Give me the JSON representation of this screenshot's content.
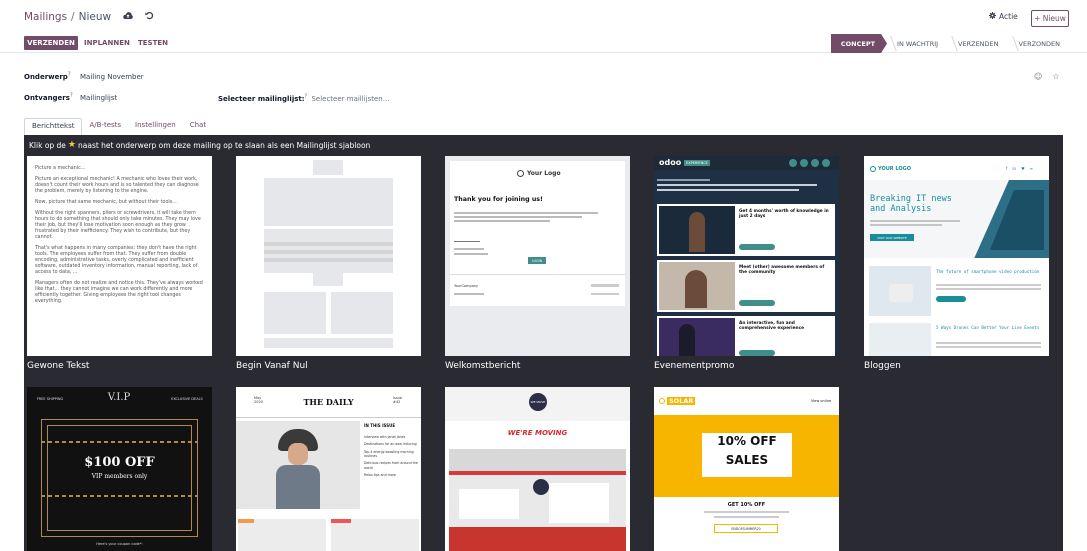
{
  "header": {
    "app": "Mailings",
    "separator": "/",
    "current": "Nieuw",
    "actie_label": "Actie",
    "new_button": "+ Nieuw"
  },
  "actionbar": {
    "send": "VERZENDEN",
    "schedule": "INPLANNEN",
    "test": "TESTEN",
    "stages": [
      "CONCEPT",
      "IN WACHTRIJ",
      "VERZENDEN",
      "VERZONDEN"
    ]
  },
  "form": {
    "subject_label": "Onderwerp",
    "subject_value": "Mailing November",
    "recipients_label": "Ontvangers",
    "recipients_value": "Mailinglijst",
    "mailinglist_label": "Selecteer mailinglijst:",
    "mailinglist_placeholder": "Selecteer maillijsten...",
    "tooltip_mark": "?"
  },
  "tabs": [
    "Berichttekst",
    "A/B-tests",
    "Instellingen",
    "Chat"
  ],
  "templates": {
    "hint_before": "Klik op de",
    "hint_after": "naast het onderwerp om deze mailing op te slaan als een Mailinglijst sjabloon",
    "names": [
      "Gewone Tekst",
      "Begin Vanaf Nul",
      "Welkomstbericht",
      "Evenementpromo",
      "Bloggen"
    ]
  },
  "thumbs": {
    "plain": {
      "p1": "Picture a mechanic...",
      "p2": "Picture an exceptional mechanic! A mechanic who loves their work, doesn't count their work hours and is so talented they can diagnose the problem, merely by listening to the engine.",
      "p3": "Now, picture that same mechanic, but without their tools...",
      "p4": "Without the right spanners, pliers or screwdrivers, it will take them hours to do something that should only take minutes. They may love their job, but they'll lose motivation soon enough as they grow frustrated by their inefficiency. They wish to contribute, but they cannot.",
      "p5": "That's what happens in many companies: they don't have the right tools. The employees suffer from that. They suffer from double encoding, administrative tasks, overly complicated and inefficient software, outdated inventory information, manual reporting, lack of access to data, ...",
      "p6": "Managers often do not realize and notice this. They've always worked like that... they cannot imagine we can work differently and more efficiently together. Giving employees the right tool changes everything."
    },
    "welcome": {
      "logo": "Your Logo",
      "title": "Thank you for joining us!",
      "button": "LOGIN",
      "company": "YourCompany"
    },
    "event": {
      "brand": "odoo",
      "tag": "EXPERIENCE",
      "e1": "Get 4 months' worth of knowledge in just 2 days",
      "e2": "Meet (other) awesome members of the community",
      "e3": "An interactive, fun and comprehensive experience"
    },
    "blog": {
      "logo": "YOUR LOGO",
      "title": "Breaking IT news and Analysis",
      "cta": "VISIT OUR WEBSITE",
      "a1": "The future of smartphone video production",
      "a2": "5 Ways Drones Can Better Your Live Events"
    },
    "vip": {
      "left": "FREE SHIPPING",
      "brand": "V.I.P",
      "right": "EXCLUSIVE DEALS",
      "offer": "$100 OFF",
      "sub": "VIP members only",
      "footer": "Here's your coupon code*:"
    },
    "daily": {
      "date": "May 2020",
      "title": "THE DAILY",
      "issue": "Issue #42",
      "inissue": "IN THIS ISSUE",
      "items": [
        "Interview with Janet Jones",
        "Destinations for an awe-inducing",
        "Top 4 energy-boosting morning routines",
        "Delicious recipes from around the world",
        "Relax tips and more"
      ]
    },
    "moving": {
      "badge": "WE MOVE",
      "title": "WE'RE MOVING"
    },
    "solar": {
      "brand": "SOLAR",
      "link": "View online",
      "big1": "10% OFF",
      "big2": "SALES",
      "get": "GET 10% OFF",
      "code": "ENDOFSUMMER20"
    }
  },
  "colors": {
    "brand": "#714b67",
    "dark_bg": "#2a2a33",
    "event_teal": "#3f8e8a",
    "blog_teal": "#1a8d9a",
    "solar_yellow": "#f7b500"
  }
}
